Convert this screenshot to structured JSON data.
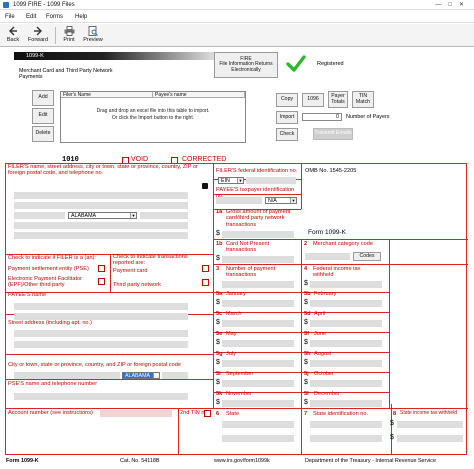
{
  "window": {
    "title": "1099 FIRE - 1099 Files"
  },
  "menu": [
    "File",
    "Edit",
    "Forms",
    "Help"
  ],
  "toolbar": {
    "back": "Back",
    "forward": "Forward",
    "print": "Print",
    "preview": "Preview"
  },
  "header": {
    "form_tag": "1099-K",
    "payer_caption": "Merchant Card and Third Party Network Payments",
    "fire_button": "FIRE\nFile Information Returns\nElectronically",
    "registered": "Registered"
  },
  "actions": {
    "add": "Add",
    "edit": "Edit",
    "delete": "Delete"
  },
  "payer_grid": {
    "col_filer": "Filer's Name",
    "col_payee": "Payee's name",
    "empty_text": "Drag and drop an excel file into this table to import.\nOr click the Import button to the right."
  },
  "side_buttons": {
    "copy": "Copy",
    "n1096": "1096",
    "payer_totals": "Payer\nTotals",
    "tin_match": "TIN\nMatch",
    "import": "Import",
    "check": "Check",
    "transmit": "Transmit Emails",
    "num_payers_value": "0",
    "num_payers_label": "Number of Payers"
  },
  "form": {
    "form_number_code": "1010",
    "void": "VOID",
    "corrected": "CORRECTED",
    "filer_name_label": "FILER'S name, street address, city or town, state or province, country, ZIP or foreign postal code, and telephone no.",
    "state_value": "ALABAMA",
    "filer_tin_label": "FILER'S federal identification no.",
    "tin_type": "EIN",
    "payee_tin_label": "PAYEE'S taxpayer identification no.",
    "payee_tin_type": "N/A",
    "omb": "OMB No. 1545-2205",
    "box1a_label": "Gross amount of payment card/third party network transactions",
    "form_title": "Form 1099-K",
    "box1b_label": "Card Not Present transactions",
    "box2_label": "Merchant category code",
    "codes_btn": "Codes",
    "box3_label": "Number of payment transactions",
    "box4_label": "Federal income tax withheld",
    "filer_is_label": "Check to indicate if FILER is a (an):",
    "pse_label": "Payment settlement entity (PSE)",
    "epf_label": "Electronic Payment Facilitator (EPF)/Other third party",
    "txn_type_label": "Check to indicate transactions reported are:",
    "payment_card": "Payment card",
    "third_party_network": "Third party network",
    "payee_name_label": "PAYEE'S name",
    "street_label": "Street address (including apt. no.)",
    "city_label": "City or town, state or province, country, and ZIP or foreign postal code",
    "payee_state_value": "ALABAMA",
    "pse_name_label": "PSE'S name and telephone number",
    "account_label": "Account number (see instructions)",
    "tin2_label": "2nd TIN not.",
    "months": [
      {
        "box": "5a",
        "name": "January"
      },
      {
        "box": "5b",
        "name": "February"
      },
      {
        "box": "5c",
        "name": "March"
      },
      {
        "box": "5d",
        "name": "April"
      },
      {
        "box": "5e",
        "name": "May"
      },
      {
        "box": "5f",
        "name": "June"
      },
      {
        "box": "5g",
        "name": "July"
      },
      {
        "box": "5h",
        "name": "August"
      },
      {
        "box": "5i",
        "name": "September"
      },
      {
        "box": "5j",
        "name": "October"
      },
      {
        "box": "5k",
        "name": "November"
      },
      {
        "box": "5l",
        "name": "December"
      }
    ],
    "box6_label": "State",
    "box7_label": "State identification no.",
    "box8_label": "State income tax withheld",
    "currency": "$"
  },
  "footer": {
    "form": "Form 1099-K",
    "cat": "Cat. No. 54118B",
    "url": "www.irs.gov/form1099k",
    "dept": "Department of the Treasury - Internal Revenue Service"
  },
  "colors": {
    "form_red": "#d22",
    "field_gray": "#dedede",
    "check_green": "#2eb82e"
  }
}
